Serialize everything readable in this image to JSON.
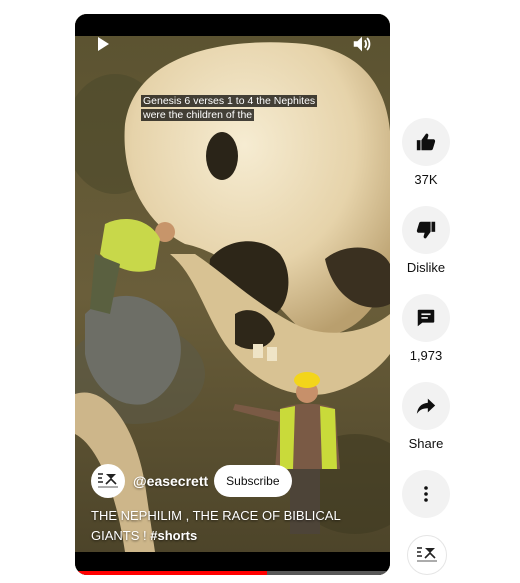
{
  "video": {
    "caption": "Genesis 6 verses 1 to 4 the Nephites were the children of the",
    "channel_handle": "@easecrett",
    "subscribe_label": "Subscribe",
    "title_text": "THE NEPHILIM , THE RACE OF BIBLICAL GIANTS ! ",
    "title_hashtag": "#shorts",
    "progress_fraction": 0.61
  },
  "actions": {
    "like_count": "37K",
    "dislike_label": "Dislike",
    "comment_count": "1,973",
    "share_label": "Share"
  },
  "icons": {
    "play": "play-icon",
    "volume": "volume-icon",
    "like": "thumbs-up-icon",
    "dislike": "thumbs-down-icon",
    "comment": "comment-icon",
    "share": "share-icon",
    "more": "more-vert-icon"
  },
  "colors": {
    "progress": "#ff0000",
    "action_bg": "#f2f2f2"
  }
}
